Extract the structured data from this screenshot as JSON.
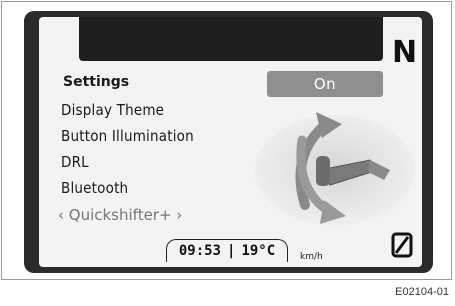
{
  "dashboard": {
    "gear_indicator": "N",
    "menu": {
      "title": "Settings",
      "items": [
        {
          "label": "Display Theme"
        },
        {
          "label": "Button Illumination"
        },
        {
          "label": "DRL"
        },
        {
          "label": "Bluetooth"
        }
      ],
      "selected_item": "‹ Quickshifter+ ›"
    },
    "status_value": "On",
    "bottom": {
      "time": "09:53",
      "separator": "|",
      "temperature": "19°C",
      "speed_unit": "km/h"
    },
    "icons": {
      "bottom_right": "zero-icon"
    }
  },
  "caption": "E02104-01"
}
